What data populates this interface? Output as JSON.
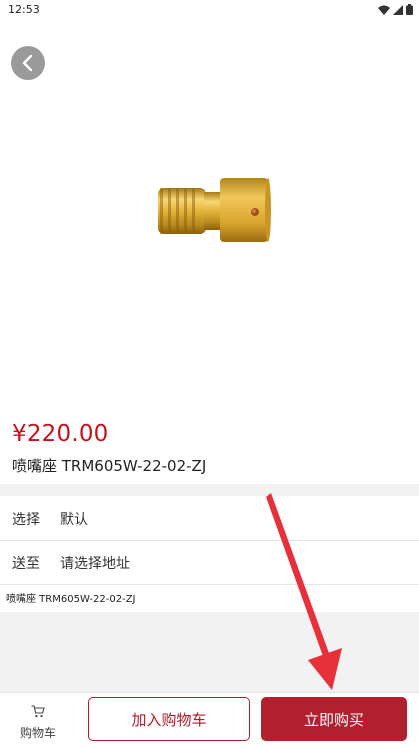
{
  "status_bar": {
    "time": "12:53",
    "icons": [
      "wifi-icon",
      "signal-icon",
      "battery-icon"
    ]
  },
  "nav": {
    "back_icon": "chevron-left-icon"
  },
  "product": {
    "price": "¥220.00",
    "title": "喷嘴座 TRM605W-22-02-ZJ",
    "image_icon": "nozzle-holder-image"
  },
  "options": [
    {
      "key": "选择",
      "value": "默认"
    },
    {
      "key": "送至",
      "value": "请选择地址"
    }
  ],
  "detail_note": "喷嘴座 TRM605W-22-02-ZJ",
  "bottom_bar": {
    "cart_label": "购物车",
    "cart_icon": "cart-icon",
    "add_to_cart": "加入购物车",
    "buy_now": "立即购买"
  },
  "colors": {
    "accent": "#b2202e",
    "price": "#c4121f",
    "annotation": "#e8303a"
  }
}
